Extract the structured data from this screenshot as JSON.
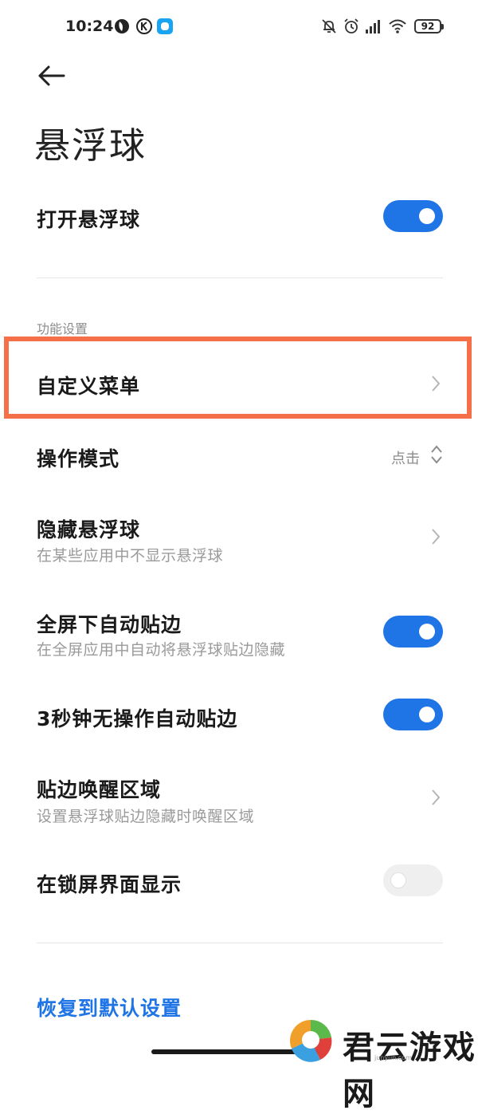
{
  "status_bar": {
    "time": "10:24",
    "battery": "92",
    "left_icons": [
      "moon-app-icon",
      "k-app-icon",
      "message-app-icon"
    ],
    "right_icons": [
      "mute-bell-icon",
      "alarm-icon",
      "signal-icon",
      "wifi-icon",
      "battery-icon"
    ]
  },
  "header": {
    "title": "悬浮球"
  },
  "toggle_main": {
    "label": "打开悬浮球",
    "on": true
  },
  "section": {
    "label": "功能设置"
  },
  "items": {
    "custom_menu": {
      "label": "自定义菜单"
    },
    "operation_mode": {
      "label": "操作模式",
      "value": "点击"
    },
    "hide_ball": {
      "label": "隐藏悬浮球",
      "sub": "在某些应用中不显示悬浮球"
    },
    "fullscreen_edge": {
      "label": "全屏下自动贴边",
      "sub": "在全屏应用中自动将悬浮球贴边隐藏",
      "on": true
    },
    "idle_edge": {
      "label": "3秒钟无操作自动贴边",
      "on": true
    },
    "wake_area": {
      "label": "贴边唤醒区域",
      "sub": "设置悬浮球贴边隐藏时唤醒区域"
    },
    "lockscreen": {
      "label": "在锁屏界面显示",
      "on": false
    }
  },
  "restore": {
    "label": "恢复到默认设置"
  },
  "watermark": {
    "text": "君云游戏网",
    "sub": "junyun.com"
  },
  "colors": {
    "accent": "#1f74e6",
    "highlight": "#f57048",
    "toggle_off": "#efefef"
  }
}
